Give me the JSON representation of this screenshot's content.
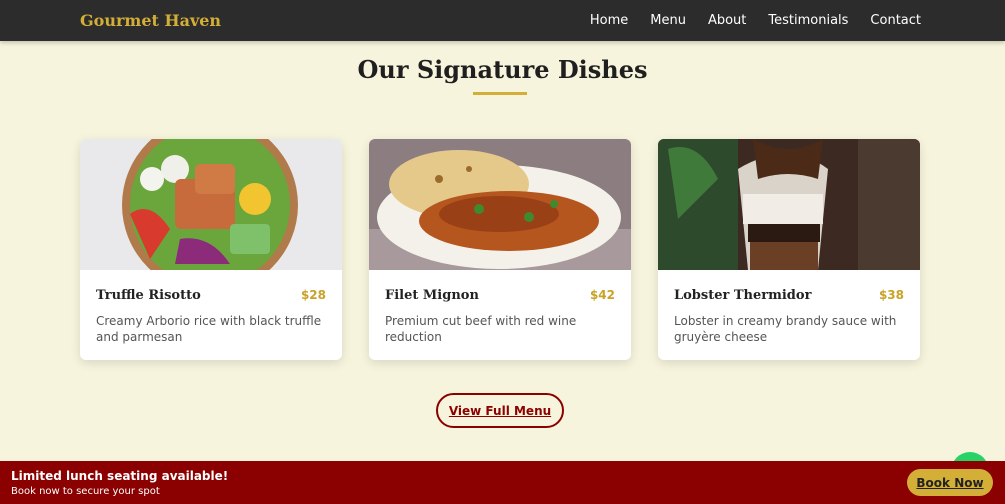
{
  "nav": {
    "brand": "Gourmet Haven",
    "links": [
      "Home",
      "Menu",
      "About",
      "Testimonials",
      "Contact"
    ]
  },
  "section": {
    "title": "Our Signature Dishes"
  },
  "dishes": [
    {
      "name": "Truffle Risotto",
      "price": "$28",
      "description": "Creamy Arborio rice with black truffle and parmesan"
    },
    {
      "name": "Filet Mignon",
      "price": "$42",
      "description": "Premium cut beef with red wine reduction"
    },
    {
      "name": "Lobster Thermidor",
      "price": "$38",
      "description": "Lobster in creamy brandy sauce with gruyère cheese"
    }
  ],
  "cta": {
    "view_menu": "View Full Menu"
  },
  "banner": {
    "title": "Limited lunch seating available!",
    "subtitle": "Book now to secure your spot",
    "button": "Book Now"
  },
  "colors": {
    "accent": "#d4af37",
    "brand_red": "#8b0000",
    "background": "#f6f4dc",
    "nav_bg": "#2c2c2c"
  }
}
